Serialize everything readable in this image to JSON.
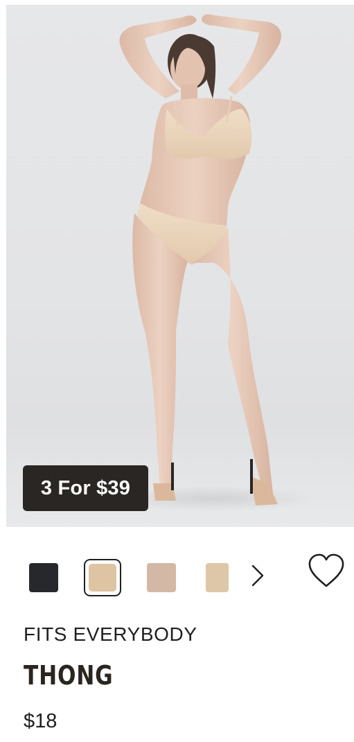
{
  "product": {
    "promo_badge": "3 For $39",
    "brand": "FITS EVERYBODY",
    "name": "THONG",
    "price": "$18",
    "image_description_icon": "product-photo",
    "swatches": [
      {
        "name": "onyx",
        "color": "#26282c",
        "selected": false
      },
      {
        "name": "clay",
        "color": "#dfc4a3",
        "selected": true
      },
      {
        "name": "sand",
        "color": "#d3b8a6",
        "selected": false
      },
      {
        "name": "butter",
        "color": "#dec6a8",
        "selected": false
      }
    ],
    "swatch_next_icon": "chevron-right-icon",
    "wishlist_icon": "heart-outline-icon"
  },
  "colors": {
    "badge_bg": "#2a2623",
    "badge_text": "#ffffff",
    "text_primary": "#1f1f1f",
    "title_text": "#2b2520",
    "image_bg": "#e4e5e7"
  }
}
